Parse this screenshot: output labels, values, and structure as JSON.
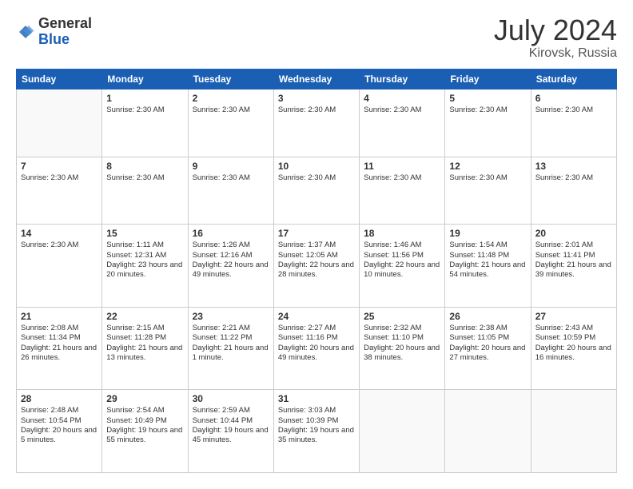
{
  "header": {
    "logo_line1": "General",
    "logo_line2": "Blue",
    "month_year": "July 2024",
    "location": "Kirovsk, Russia"
  },
  "days_of_week": [
    "Sunday",
    "Monday",
    "Tuesday",
    "Wednesday",
    "Thursday",
    "Friday",
    "Saturday"
  ],
  "weeks": [
    [
      {
        "day": "",
        "info": []
      },
      {
        "day": "1",
        "info": [
          "Sunrise: 2:30 AM"
        ]
      },
      {
        "day": "2",
        "info": [
          "Sunrise: 2:30 AM"
        ]
      },
      {
        "day": "3",
        "info": [
          "Sunrise: 2:30 AM"
        ]
      },
      {
        "day": "4",
        "info": [
          "Sunrise: 2:30 AM"
        ]
      },
      {
        "day": "5",
        "info": [
          "Sunrise: 2:30 AM"
        ]
      },
      {
        "day": "6",
        "info": [
          "Sunrise: 2:30 AM"
        ]
      }
    ],
    [
      {
        "day": "7",
        "info": [
          "Sunrise: 2:30 AM"
        ]
      },
      {
        "day": "8",
        "info": [
          "Sunrise: 2:30 AM"
        ]
      },
      {
        "day": "9",
        "info": [
          "Sunrise: 2:30 AM"
        ]
      },
      {
        "day": "10",
        "info": [
          "Sunrise: 2:30 AM"
        ]
      },
      {
        "day": "11",
        "info": [
          "Sunrise: 2:30 AM"
        ]
      },
      {
        "day": "12",
        "info": [
          "Sunrise: 2:30 AM"
        ]
      },
      {
        "day": "13",
        "info": [
          "Sunrise: 2:30 AM"
        ]
      }
    ],
    [
      {
        "day": "14",
        "info": [
          "Sunrise: 2:30 AM"
        ]
      },
      {
        "day": "15",
        "info": [
          "Sunrise: 1:11 AM",
          "Sunset: 12:31 AM",
          "Daylight: 23 hours and 20 minutes."
        ]
      },
      {
        "day": "16",
        "info": [
          "Sunrise: 1:26 AM",
          "Sunset: 12:16 AM",
          "Daylight: 22 hours and 49 minutes."
        ]
      },
      {
        "day": "17",
        "info": [
          "Sunrise: 1:37 AM",
          "Sunset: 12:05 AM",
          "Daylight: 22 hours and 28 minutes."
        ]
      },
      {
        "day": "18",
        "info": [
          "Sunrise: 1:46 AM",
          "Sunset: 11:56 PM",
          "Daylight: 22 hours and 10 minutes."
        ]
      },
      {
        "day": "19",
        "info": [
          "Sunrise: 1:54 AM",
          "Sunset: 11:48 PM",
          "Daylight: 21 hours and 54 minutes."
        ]
      },
      {
        "day": "20",
        "info": [
          "Sunrise: 2:01 AM",
          "Sunset: 11:41 PM",
          "Daylight: 21 hours and 39 minutes."
        ]
      }
    ],
    [
      {
        "day": "21",
        "info": [
          "Sunrise: 2:08 AM",
          "Sunset: 11:34 PM",
          "Daylight: 21 hours and 26 minutes."
        ]
      },
      {
        "day": "22",
        "info": [
          "Sunrise: 2:15 AM",
          "Sunset: 11:28 PM",
          "Daylight: 21 hours and 13 minutes."
        ]
      },
      {
        "day": "23",
        "info": [
          "Sunrise: 2:21 AM",
          "Sunset: 11:22 PM",
          "Daylight: 21 hours and 1 minute."
        ]
      },
      {
        "day": "24",
        "info": [
          "Sunrise: 2:27 AM",
          "Sunset: 11:16 PM",
          "Daylight: 20 hours and 49 minutes."
        ]
      },
      {
        "day": "25",
        "info": [
          "Sunrise: 2:32 AM",
          "Sunset: 11:10 PM",
          "Daylight: 20 hours and 38 minutes."
        ]
      },
      {
        "day": "26",
        "info": [
          "Sunrise: 2:38 AM",
          "Sunset: 11:05 PM",
          "Daylight: 20 hours and 27 minutes."
        ]
      },
      {
        "day": "27",
        "info": [
          "Sunrise: 2:43 AM",
          "Sunset: 10:59 PM",
          "Daylight: 20 hours and 16 minutes."
        ]
      }
    ],
    [
      {
        "day": "28",
        "info": [
          "Sunrise: 2:48 AM",
          "Sunset: 10:54 PM",
          "Daylight: 20 hours and 5 minutes."
        ]
      },
      {
        "day": "29",
        "info": [
          "Sunrise: 2:54 AM",
          "Sunset: 10:49 PM",
          "Daylight: 19 hours and 55 minutes."
        ]
      },
      {
        "day": "30",
        "info": [
          "Sunrise: 2:59 AM",
          "Sunset: 10:44 PM",
          "Daylight: 19 hours and 45 minutes."
        ]
      },
      {
        "day": "31",
        "info": [
          "Sunrise: 3:03 AM",
          "Sunset: 10:39 PM",
          "Daylight: 19 hours and 35 minutes."
        ]
      },
      {
        "day": "",
        "info": []
      },
      {
        "day": "",
        "info": []
      },
      {
        "day": "",
        "info": []
      }
    ]
  ]
}
